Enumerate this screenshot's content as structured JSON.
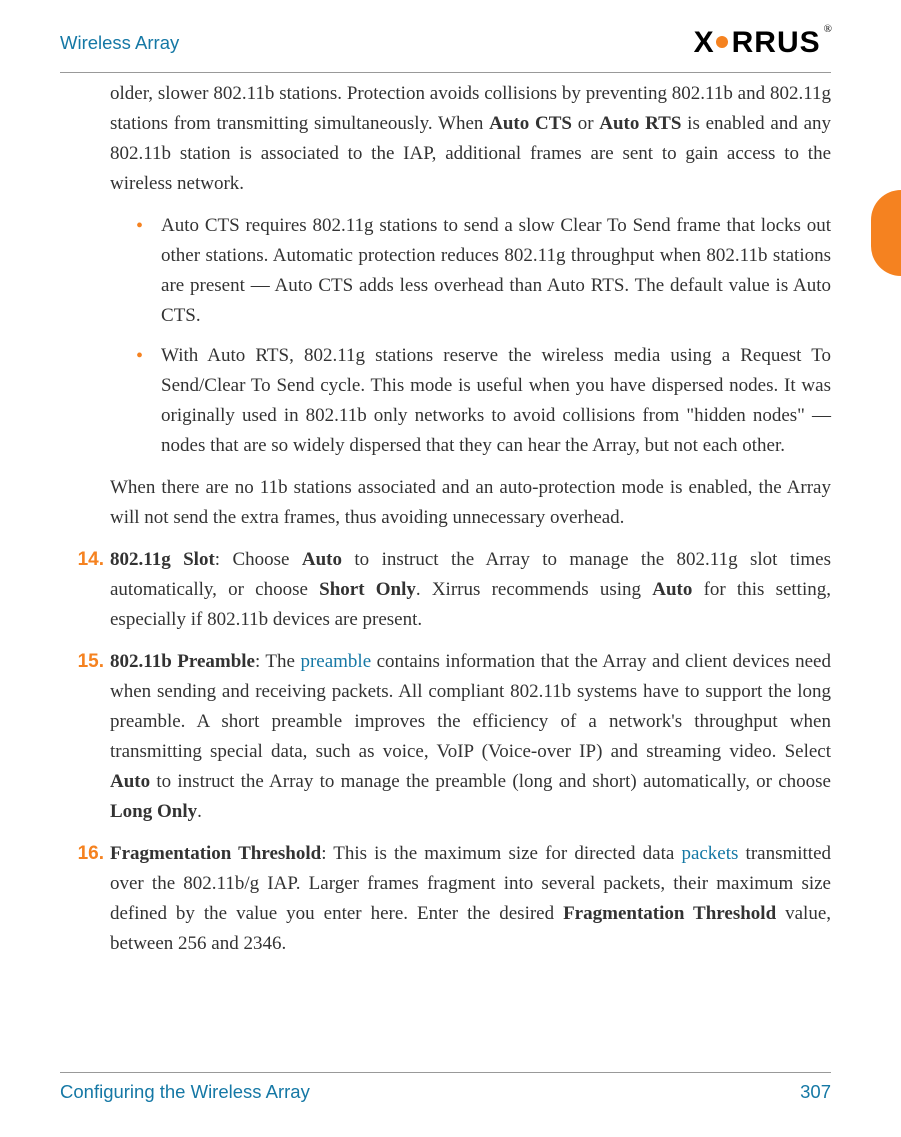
{
  "header": {
    "title": "Wireless Array",
    "logo_x": "X",
    "logo_rest": "RRUS",
    "logo_reg": "®"
  },
  "p_intro": {
    "t1": "older, slower 802.11b stations. Protection avoids collisions by preventing 802.11b and 802.11g stations from transmitting simultaneously. When ",
    "b1": "Auto CTS",
    "t2": " or ",
    "b2": "Auto RTS",
    "t3": " is enabled and any 802.11b station is associated to the IAP, additional frames are sent to gain access to the wireless network."
  },
  "bullets": {
    "b1": "Auto CTS requires 802.11g stations to send a slow Clear To Send frame that locks out other stations. Automatic protection reduces 802.11g throughput when 802.11b stations are present — Auto CTS adds less overhead than Auto RTS. The default value is Auto CTS.",
    "b2": "With Auto RTS, 802.11g stations reserve the wireless media using a Request To Send/Clear To Send cycle. This mode is useful when you have dispersed nodes. It was originally used in 802.11b only networks to avoid collisions from \"hidden nodes\" — nodes that are so widely dispersed that they can hear the Array, but not each other."
  },
  "p_after": "When there are no 11b stations associated and an auto-protection mode is enabled, the Array will not send the extra frames, thus avoiding unnecessary overhead.",
  "item14": {
    "num": "14.",
    "b1": "802.11g Slot",
    "t1": ": Choose ",
    "b2": "Auto",
    "t2": " to instruct the Array to manage the 802.11g slot times automatically, or choose ",
    "b3": "Short Only",
    "t3": ". Xirrus recommends using ",
    "b4": "Auto",
    "t4": " for this setting, especially if 802.11b devices are present."
  },
  "item15": {
    "num": "15.",
    "b1": "802.11b Preamble",
    "t1": ": The ",
    "l1": "preamble",
    "t2": " contains information that the Array and client devices need when sending and receiving packets. All compliant 802.11b systems have to support the long preamble. A short preamble improves the efficiency of a network's throughput when transmitting special data, such as voice, VoIP (Voice-over IP) and streaming video. Select ",
    "b2": "Auto",
    "t3": " to instruct the Array to manage the preamble (long and short) automatically, or choose ",
    "b3": "Long Only",
    "t4": "."
  },
  "item16": {
    "num": "16.",
    "b1": "Fragmentation Threshold",
    "t1": ": This is the maximum size for directed data ",
    "l1": "packets",
    "t2": " transmitted over the 802.11b/g IAP. Larger frames fragment into several packets, their maximum size defined by the value you enter here. Enter the desired ",
    "b2": "Fragmentation Threshold",
    "t3": " value, between 256 and 2346."
  },
  "footer": {
    "section": "Configuring the Wireless Array",
    "page": "307"
  }
}
